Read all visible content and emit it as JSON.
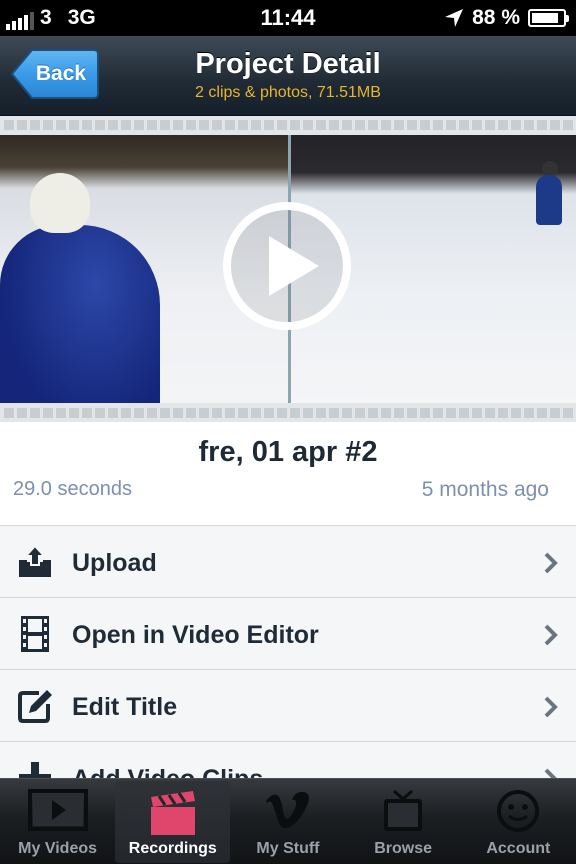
{
  "status_bar": {
    "carrier": "3",
    "network": "3G",
    "time": "11:44",
    "battery": "88 %"
  },
  "nav": {
    "back_label": "Back",
    "title": "Project Detail",
    "subtitle": "2 clips & photos, 71.51MB",
    "subtitle_color": "#e6b531"
  },
  "video": {
    "play_icon": "play-circle-icon"
  },
  "project": {
    "title": "fre, 01 apr #2",
    "duration": "29.0 seconds",
    "age": "5 months ago"
  },
  "menu": {
    "items": [
      {
        "label": "Upload",
        "icon": "upload-tray-icon"
      },
      {
        "label": "Open in Video Editor",
        "icon": "film-strip-icon"
      },
      {
        "label": "Edit Title",
        "icon": "edit-pencil-icon"
      },
      {
        "label": "Add Video Clips",
        "icon": "plus-icon"
      }
    ]
  },
  "tabs": {
    "items": [
      {
        "label": "My Videos",
        "icon": "video-play-icon",
        "active": false
      },
      {
        "label": "Recordings",
        "icon": "clapperboard-icon",
        "active": true
      },
      {
        "label": "My Stuff",
        "icon": "vimeo-v-icon",
        "active": false
      },
      {
        "label": "Browse",
        "icon": "tv-icon",
        "active": false
      },
      {
        "label": "Account",
        "icon": "smiley-face-icon",
        "active": false
      }
    ]
  },
  "colors": {
    "nav_top": "#3e4a56",
    "nav_bottom": "#16202a",
    "back_button": "#3a9be8",
    "meta_text": "#7e8fb3",
    "clapper_red": "#e0456b"
  }
}
